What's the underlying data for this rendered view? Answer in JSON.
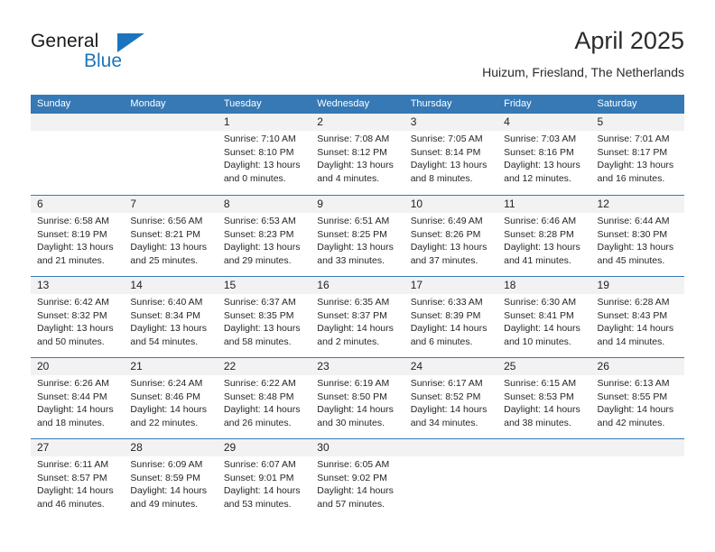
{
  "branding": {
    "logo_text_primary": "General",
    "logo_text_secondary": "Blue",
    "accent_color": "#1c75bc",
    "header_color": "#3679b5"
  },
  "header": {
    "title": "April 2025",
    "subtitle": "Huizum, Friesland, The Netherlands"
  },
  "calendar": {
    "weekdays": [
      "Sunday",
      "Monday",
      "Tuesday",
      "Wednesday",
      "Thursday",
      "Friday",
      "Saturday"
    ],
    "weeks": [
      [
        {
          "day": ""
        },
        {
          "day": ""
        },
        {
          "day": "1",
          "sunrise": "Sunrise: 7:10 AM",
          "sunset": "Sunset: 8:10 PM",
          "daylight1": "Daylight: 13 hours",
          "daylight2": "and 0 minutes."
        },
        {
          "day": "2",
          "sunrise": "Sunrise: 7:08 AM",
          "sunset": "Sunset: 8:12 PM",
          "daylight1": "Daylight: 13 hours",
          "daylight2": "and 4 minutes."
        },
        {
          "day": "3",
          "sunrise": "Sunrise: 7:05 AM",
          "sunset": "Sunset: 8:14 PM",
          "daylight1": "Daylight: 13 hours",
          "daylight2": "and 8 minutes."
        },
        {
          "day": "4",
          "sunrise": "Sunrise: 7:03 AM",
          "sunset": "Sunset: 8:16 PM",
          "daylight1": "Daylight: 13 hours",
          "daylight2": "and 12 minutes."
        },
        {
          "day": "5",
          "sunrise": "Sunrise: 7:01 AM",
          "sunset": "Sunset: 8:17 PM",
          "daylight1": "Daylight: 13 hours",
          "daylight2": "and 16 minutes."
        }
      ],
      [
        {
          "day": "6",
          "sunrise": "Sunrise: 6:58 AM",
          "sunset": "Sunset: 8:19 PM",
          "daylight1": "Daylight: 13 hours",
          "daylight2": "and 21 minutes."
        },
        {
          "day": "7",
          "sunrise": "Sunrise: 6:56 AM",
          "sunset": "Sunset: 8:21 PM",
          "daylight1": "Daylight: 13 hours",
          "daylight2": "and 25 minutes."
        },
        {
          "day": "8",
          "sunrise": "Sunrise: 6:53 AM",
          "sunset": "Sunset: 8:23 PM",
          "daylight1": "Daylight: 13 hours",
          "daylight2": "and 29 minutes."
        },
        {
          "day": "9",
          "sunrise": "Sunrise: 6:51 AM",
          "sunset": "Sunset: 8:25 PM",
          "daylight1": "Daylight: 13 hours",
          "daylight2": "and 33 minutes."
        },
        {
          "day": "10",
          "sunrise": "Sunrise: 6:49 AM",
          "sunset": "Sunset: 8:26 PM",
          "daylight1": "Daylight: 13 hours",
          "daylight2": "and 37 minutes."
        },
        {
          "day": "11",
          "sunrise": "Sunrise: 6:46 AM",
          "sunset": "Sunset: 8:28 PM",
          "daylight1": "Daylight: 13 hours",
          "daylight2": "and 41 minutes."
        },
        {
          "day": "12",
          "sunrise": "Sunrise: 6:44 AM",
          "sunset": "Sunset: 8:30 PM",
          "daylight1": "Daylight: 13 hours",
          "daylight2": "and 45 minutes."
        }
      ],
      [
        {
          "day": "13",
          "sunrise": "Sunrise: 6:42 AM",
          "sunset": "Sunset: 8:32 PM",
          "daylight1": "Daylight: 13 hours",
          "daylight2": "and 50 minutes."
        },
        {
          "day": "14",
          "sunrise": "Sunrise: 6:40 AM",
          "sunset": "Sunset: 8:34 PM",
          "daylight1": "Daylight: 13 hours",
          "daylight2": "and 54 minutes."
        },
        {
          "day": "15",
          "sunrise": "Sunrise: 6:37 AM",
          "sunset": "Sunset: 8:35 PM",
          "daylight1": "Daylight: 13 hours",
          "daylight2": "and 58 minutes."
        },
        {
          "day": "16",
          "sunrise": "Sunrise: 6:35 AM",
          "sunset": "Sunset: 8:37 PM",
          "daylight1": "Daylight: 14 hours",
          "daylight2": "and 2 minutes."
        },
        {
          "day": "17",
          "sunrise": "Sunrise: 6:33 AM",
          "sunset": "Sunset: 8:39 PM",
          "daylight1": "Daylight: 14 hours",
          "daylight2": "and 6 minutes."
        },
        {
          "day": "18",
          "sunrise": "Sunrise: 6:30 AM",
          "sunset": "Sunset: 8:41 PM",
          "daylight1": "Daylight: 14 hours",
          "daylight2": "and 10 minutes."
        },
        {
          "day": "19",
          "sunrise": "Sunrise: 6:28 AM",
          "sunset": "Sunset: 8:43 PM",
          "daylight1": "Daylight: 14 hours",
          "daylight2": "and 14 minutes."
        }
      ],
      [
        {
          "day": "20",
          "sunrise": "Sunrise: 6:26 AM",
          "sunset": "Sunset: 8:44 PM",
          "daylight1": "Daylight: 14 hours",
          "daylight2": "and 18 minutes."
        },
        {
          "day": "21",
          "sunrise": "Sunrise: 6:24 AM",
          "sunset": "Sunset: 8:46 PM",
          "daylight1": "Daylight: 14 hours",
          "daylight2": "and 22 minutes."
        },
        {
          "day": "22",
          "sunrise": "Sunrise: 6:22 AM",
          "sunset": "Sunset: 8:48 PM",
          "daylight1": "Daylight: 14 hours",
          "daylight2": "and 26 minutes."
        },
        {
          "day": "23",
          "sunrise": "Sunrise: 6:19 AM",
          "sunset": "Sunset: 8:50 PM",
          "daylight1": "Daylight: 14 hours",
          "daylight2": "and 30 minutes."
        },
        {
          "day": "24",
          "sunrise": "Sunrise: 6:17 AM",
          "sunset": "Sunset: 8:52 PM",
          "daylight1": "Daylight: 14 hours",
          "daylight2": "and 34 minutes."
        },
        {
          "day": "25",
          "sunrise": "Sunrise: 6:15 AM",
          "sunset": "Sunset: 8:53 PM",
          "daylight1": "Daylight: 14 hours",
          "daylight2": "and 38 minutes."
        },
        {
          "day": "26",
          "sunrise": "Sunrise: 6:13 AM",
          "sunset": "Sunset: 8:55 PM",
          "daylight1": "Daylight: 14 hours",
          "daylight2": "and 42 minutes."
        }
      ],
      [
        {
          "day": "27",
          "sunrise": "Sunrise: 6:11 AM",
          "sunset": "Sunset: 8:57 PM",
          "daylight1": "Daylight: 14 hours",
          "daylight2": "and 46 minutes."
        },
        {
          "day": "28",
          "sunrise": "Sunrise: 6:09 AM",
          "sunset": "Sunset: 8:59 PM",
          "daylight1": "Daylight: 14 hours",
          "daylight2": "and 49 minutes."
        },
        {
          "day": "29",
          "sunrise": "Sunrise: 6:07 AM",
          "sunset": "Sunset: 9:01 PM",
          "daylight1": "Daylight: 14 hours",
          "daylight2": "and 53 minutes."
        },
        {
          "day": "30",
          "sunrise": "Sunrise: 6:05 AM",
          "sunset": "Sunset: 9:02 PM",
          "daylight1": "Daylight: 14 hours",
          "daylight2": "and 57 minutes."
        },
        {
          "day": ""
        },
        {
          "day": ""
        },
        {
          "day": ""
        }
      ]
    ]
  }
}
